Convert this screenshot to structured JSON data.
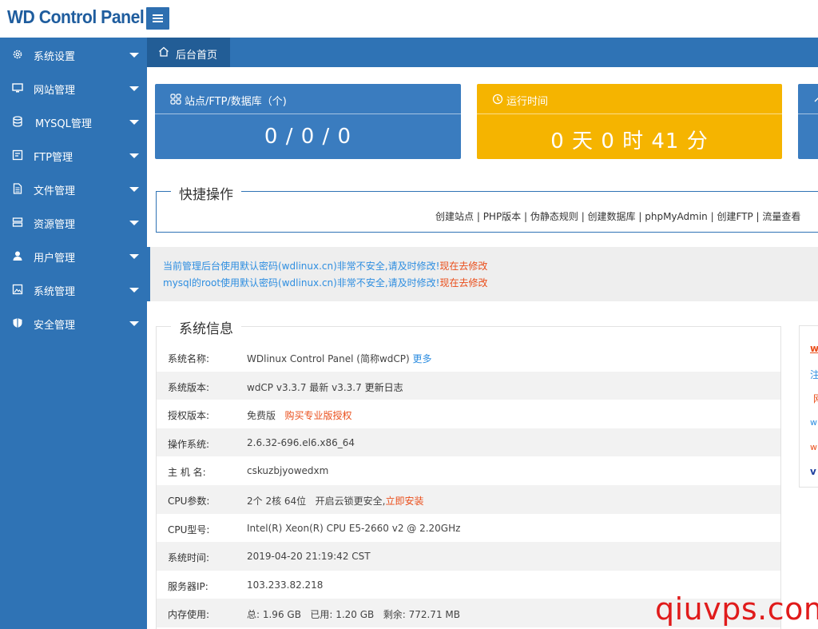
{
  "header": {
    "logo": "WD Control Panel",
    "menu_toggle_icon": "hamburger-icon"
  },
  "colors": {
    "sidebar": "#2f73b5",
    "card_blue": "#3a7cbf",
    "card_orange": "#f5b400",
    "link_blue": "#2e8ee0",
    "link_red": "#ea4e1b",
    "watermark": "#e01b1b"
  },
  "sidebar": {
    "items": [
      {
        "label": "系统设置",
        "icon": "gear-icon"
      },
      {
        "label": "网站管理",
        "icon": "monitor-icon"
      },
      {
        "label": "MYSQL管理",
        "icon": "database-icon"
      },
      {
        "label": "FTP管理",
        "icon": "ftp-icon"
      },
      {
        "label": "文件管理",
        "icon": "file-icon"
      },
      {
        "label": "资源管理",
        "icon": "server-icon"
      },
      {
        "label": "用户管理",
        "icon": "user-icon"
      },
      {
        "label": "系统管理",
        "icon": "image-icon"
      },
      {
        "label": "安全管理",
        "icon": "shield-icon"
      }
    ]
  },
  "tabs": {
    "home": "后台首页",
    "home_icon": "home-icon"
  },
  "cards": [
    {
      "title": "站点/FTP/数据库（个)",
      "value": "0 / 0 / 0",
      "icon": "grid-icon",
      "color": "blue"
    },
    {
      "title": "运行时间",
      "value": "0 天 0 时 41 分",
      "icon": "clock-icon",
      "color": "orange"
    }
  ],
  "quick": {
    "title": "快捷操作",
    "links": [
      "创建站点",
      "PHP版本",
      "伪静态规则",
      "创建数据库",
      "phpMyAdmin",
      "创建FTP",
      "流量查看"
    ],
    "separator": " | "
  },
  "alerts": [
    {
      "message": "当前管理后台使用默认密码(wdlinux.cn)非常不安全,请及时修改!",
      "action": "现在去修改"
    },
    {
      "message": "mysql的root使用默认密码(wdlinux.cn)非常不安全,请及时修改!",
      "action": "现在去修改"
    }
  ],
  "sysinfo": {
    "title": "系统信息",
    "rows": [
      {
        "key": "系统名称:",
        "value": "WDlinux Control Panel (简称wdCP)",
        "link": "更多"
      },
      {
        "key": "系统版本:",
        "value": "wdCP v3.3.7 最新 v3.3.7",
        "link": "更新日志"
      },
      {
        "key": "授权版本:",
        "value": "免费版",
        "link": "购买专业版授权"
      },
      {
        "key": "操作系统:",
        "value": "2.6.32-696.el6.x86_64"
      },
      {
        "key": "主 机 名:",
        "value": "cskuzbjyowedxm"
      },
      {
        "key": "CPU参数:",
        "value": "2个 2核 64位   开启云锁更安全,",
        "link": "立即安装"
      },
      {
        "key": "CPU型号:",
        "value": "Intel(R) Xeon(R) CPU E5-2660 v2 @ 2.20GHz"
      },
      {
        "key": "系统时间:",
        "value": "2019-04-20 21:19:42 CST"
      },
      {
        "key": "服务器IP:",
        "value": "103.233.82.218"
      },
      {
        "key": "内存使用:",
        "value": "总: 1.96 GB   已用: 1.20 GB   剩余: 772.71 MB"
      }
    ]
  },
  "right_panel": {
    "items": [
      "w",
      "注",
      "网",
      "w",
      "w",
      "v"
    ]
  },
  "watermark": "qiuvps.com"
}
